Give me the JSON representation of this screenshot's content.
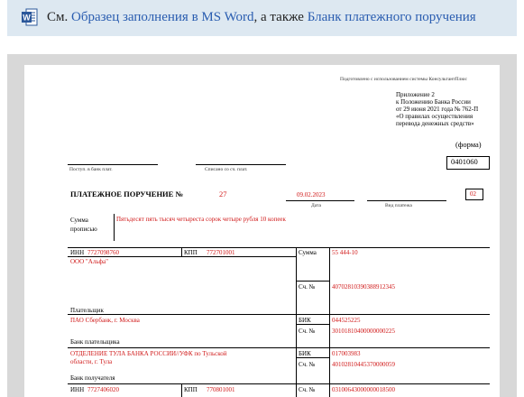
{
  "topbar": {
    "prefix": "См.",
    "link1": "Образец заполнения в MS Word",
    "middle": ", а также",
    "link2": "Бланк платежного поручения",
    "icon": "word-icon"
  },
  "doc": {
    "prepared": "Подготовлено с использованием системы КонсультантПлюс",
    "appendix": [
      "Приложение 2",
      "к Положению Банка России",
      "от 29 июня 2021 года № 762-П",
      "«О правилах осуществления",
      "перевода денежных средств»"
    ],
    "forma": "(форма)",
    "form_code": "0401060",
    "received_label": "Поступ. в банк плат.",
    "debited_label": "Списано со сч. плат.",
    "title": "ПЛАТЕЖНОЕ ПОРУЧЕНИЕ №",
    "number": "27",
    "date": "09.02.2023",
    "date_label": "Дата",
    "payment_type_label": "Вид платежа",
    "status": "02",
    "amount_words_label_1": "Сумма",
    "amount_words_label_2": "прописью",
    "amount_words": "Пятьдесят пять тысяч четыреста сорок четыре рубля 10 копеек",
    "inn_label": "ИНН",
    "payer_inn": "7727098760",
    "kpp_label": "КПП",
    "payer_kpp": "772701001",
    "sum_label": "Сумма",
    "sum_value": "55 444-10",
    "payer_name": "ООО \"Альфа\"",
    "account_label": "Сч. №",
    "payer_account": "40702810390388912345",
    "payer_label": "Плательщик",
    "payer_bank": "ПАО Сбербанк, г. Москва",
    "bik_label": "БИК",
    "payer_bik": "044525225",
    "payer_corr_account": "30101810400000000225",
    "payer_bank_label": "Банк плательщика",
    "payee_bank_line1": "ОТДЕЛЕНИЕ ТУЛА БАНКА РОССИИ//УФК по Тульской",
    "payee_bank_line2": "области, г. Тула",
    "payee_bik": "017003983",
    "payee_bank_account": "40102810445370000059",
    "payee_bank_label": "Банк получателя",
    "payee_inn": "7727406020",
    "payee_kpp": "770801001",
    "payee_account": "03100643000000018500"
  }
}
